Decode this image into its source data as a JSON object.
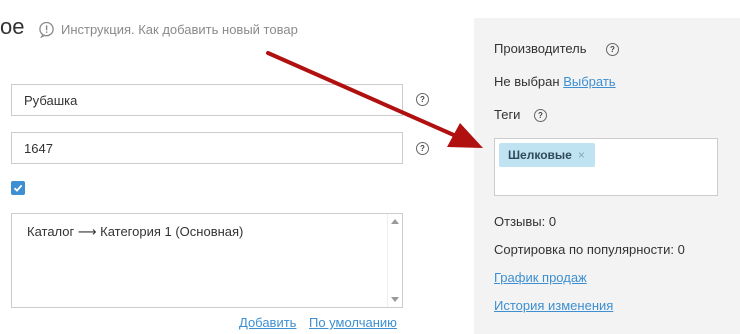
{
  "header": {
    "title_fragment": "ое",
    "help_link": "Инструкция. Как добавить новый товар"
  },
  "form": {
    "name_value": "Рубашка",
    "code_value": "1647",
    "help_glyph": "?",
    "visible_checked": true,
    "category_path": "Каталог ⟶ Категория 1 (Основная)",
    "add_label": "Добавить",
    "default_label": "По умолчанию"
  },
  "sidebar": {
    "manufacturer_label": "Производитель",
    "manufacturer_value": "Не выбран",
    "manufacturer_choose": "Выбрать",
    "tags_label": "Теги",
    "tags": [
      "Шелковые"
    ],
    "tag_remove_glyph": "×",
    "reviews_text": "Отзывы:  0",
    "popularity_text": "Сортировка по популярности: 0",
    "sales_chart_link": "График продаж",
    "history_link": "История изменения"
  },
  "colors": {
    "accent": "#3d8fd1",
    "arrow": "#b01010",
    "panel_bg": "#f3f3f3",
    "tag_bg": "#bfe3f1"
  },
  "icons": [
    "help-icon",
    "checkmark-icon",
    "close-icon",
    "scroll-up-icon",
    "scroll-down-icon"
  ]
}
